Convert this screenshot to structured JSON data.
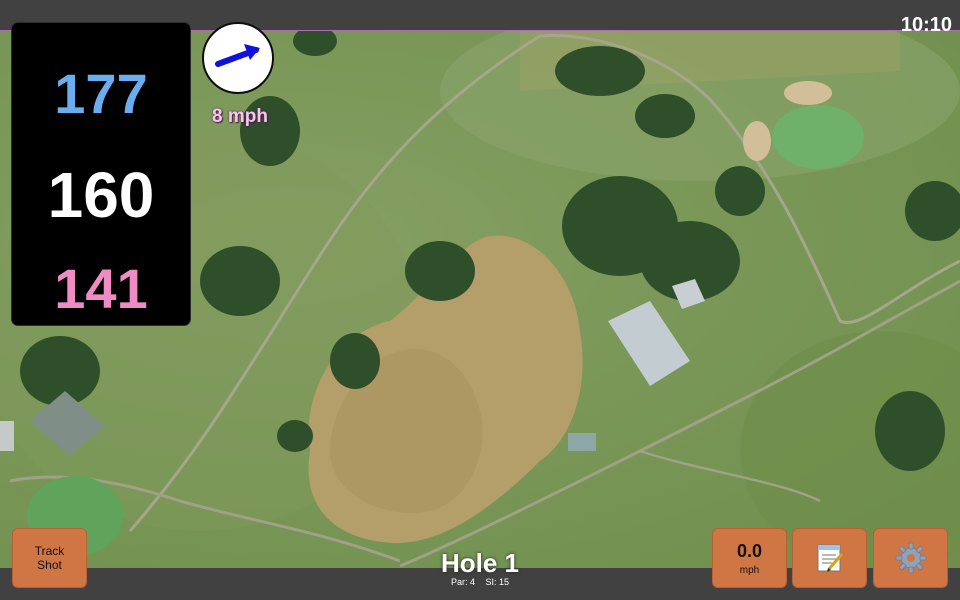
{
  "status_bar": {
    "time": "10:10"
  },
  "distances": {
    "back": "177",
    "middle": "160",
    "front": "141"
  },
  "wind": {
    "speed_label": "8 mph",
    "direction_icon": "arrow-icon",
    "arrow_color": "#1010e0"
  },
  "buttons": {
    "track_shot": {
      "label_line1": "Track",
      "label_line2": "Shot"
    },
    "speed": {
      "value": "0.0",
      "unit": "mph"
    },
    "notes": {
      "icon": "notepad-icon"
    },
    "settings": {
      "icon": "gear-icon"
    }
  },
  "hole": {
    "title": "Hole 1",
    "par": "Par: 4",
    "si": "SI: 15"
  },
  "colors": {
    "button": "#d07645",
    "back_distance": "#6aaef0",
    "front_distance": "#f08cc4",
    "accent": "#b46ab8"
  }
}
